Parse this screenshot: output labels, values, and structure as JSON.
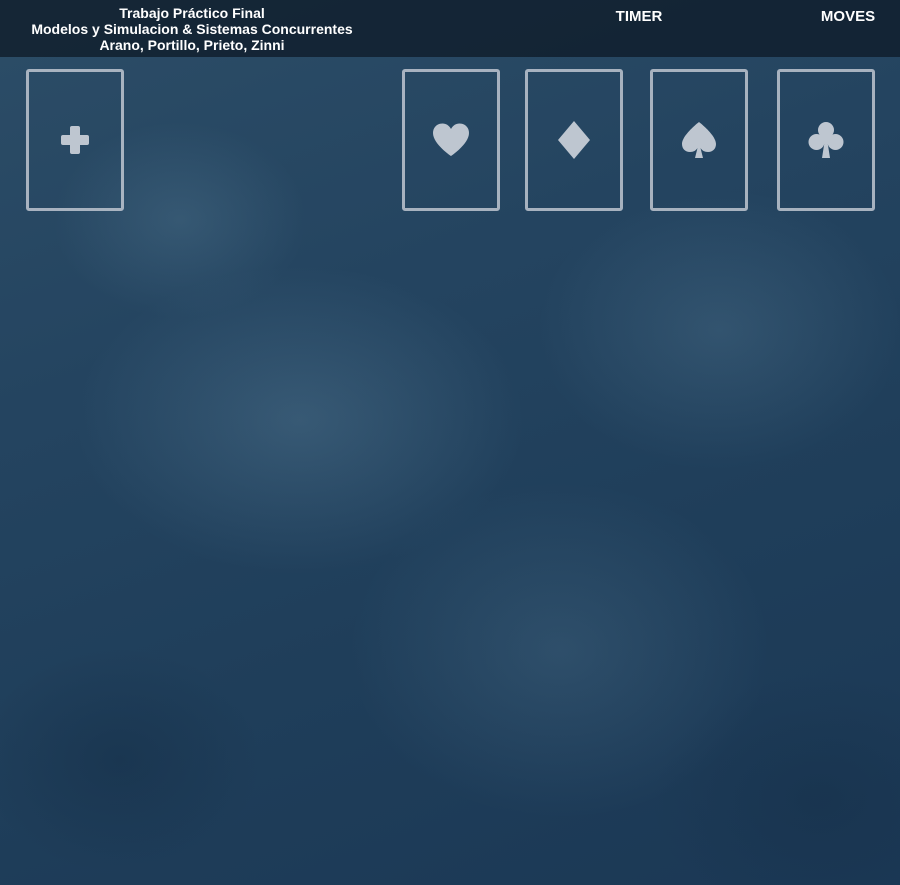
{
  "header": {
    "title_line1": "Trabajo Práctico Final",
    "title_line2": "Modelos y Simulacion & Sistemas Concurrentes",
    "title_line3": "Arano, Portillo, Prieto, Zinni",
    "timer_label": "TIMER",
    "moves_label": "MOVES"
  },
  "board": {
    "stock_slot": {
      "icon": "plus-icon"
    },
    "foundations": [
      {
        "suit": "hearts",
        "icon": "heart-icon"
      },
      {
        "suit": "diamonds",
        "icon": "diamond-icon"
      },
      {
        "suit": "spades",
        "icon": "spade-icon"
      },
      {
        "suit": "clubs",
        "icon": "club-icon"
      }
    ]
  },
  "colors": {
    "background": "#22425e",
    "header_bg": "#0c1824",
    "slot_outline": "#bec6d0",
    "header_text": "#ffffff"
  }
}
